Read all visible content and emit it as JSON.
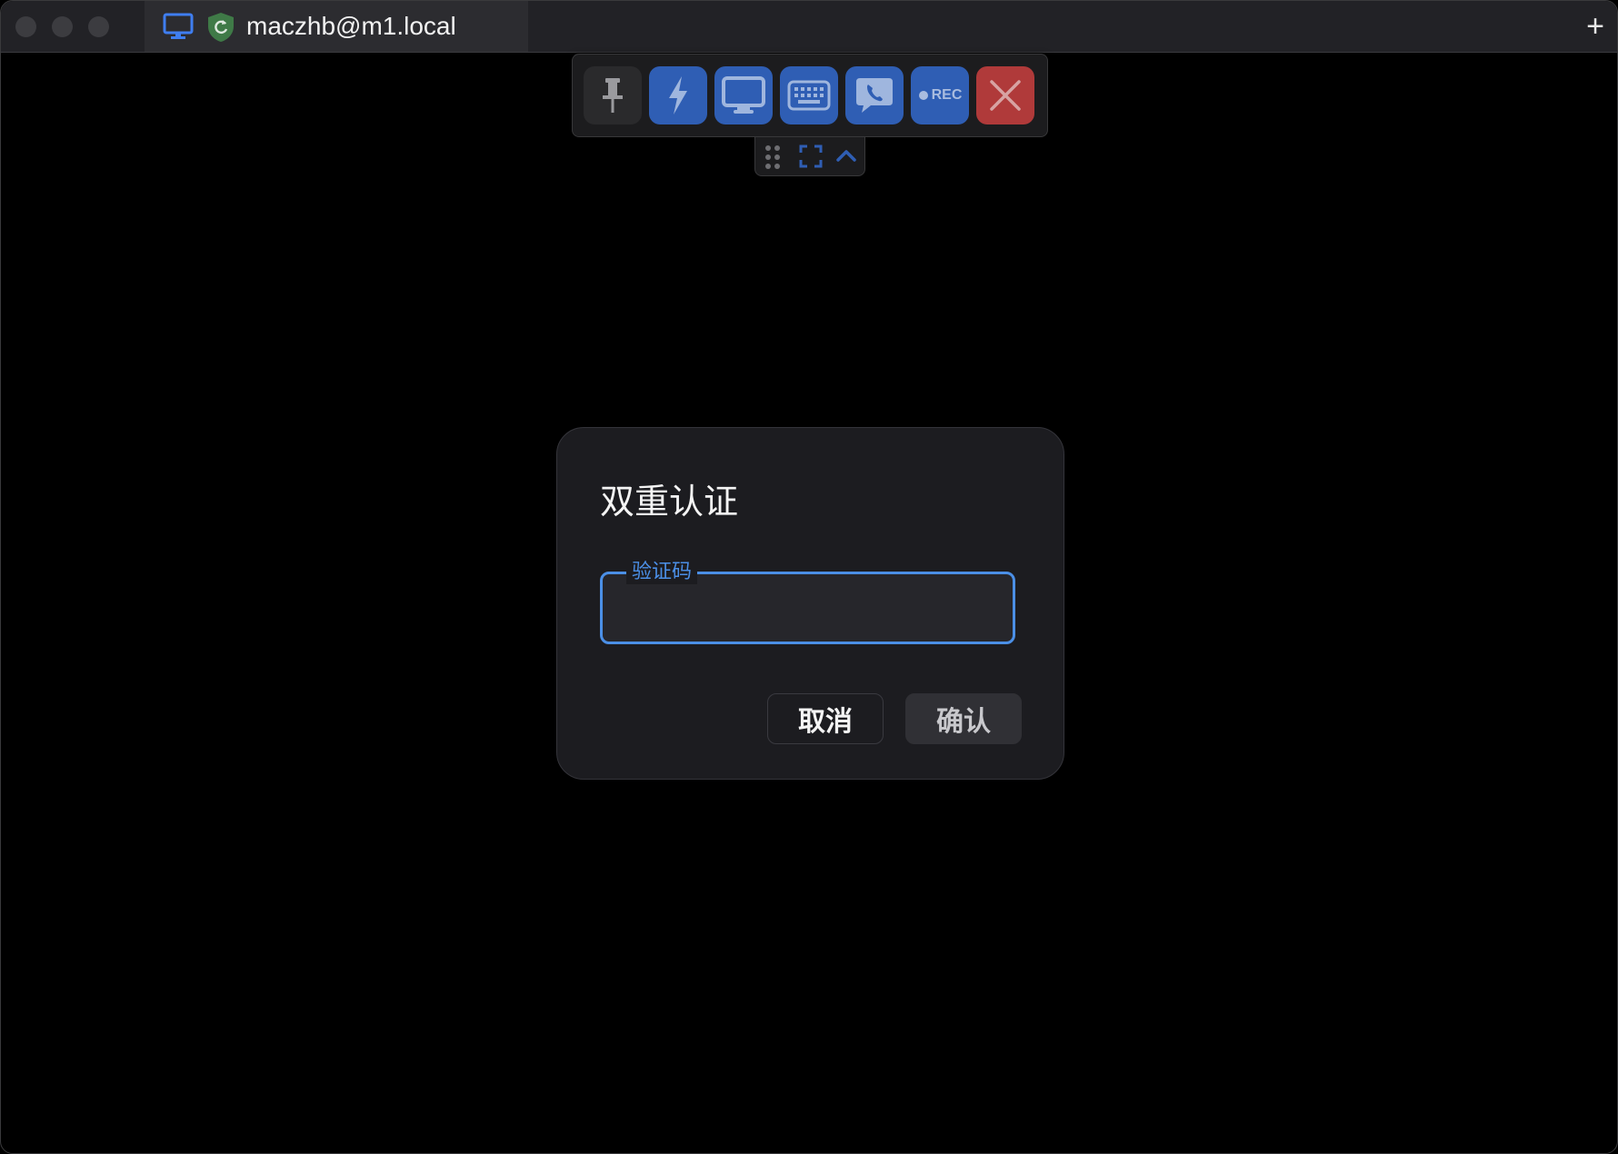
{
  "window": {
    "tab_title": "maczhb@m1.local",
    "add_tab_label": "+"
  },
  "toolbar": {
    "buttons": [
      {
        "name": "pin",
        "icon": "pin-icon"
      },
      {
        "name": "action",
        "icon": "lightning-icon"
      },
      {
        "name": "display",
        "icon": "monitor-icon"
      },
      {
        "name": "keyboard",
        "icon": "keyboard-icon"
      },
      {
        "name": "chat",
        "icon": "chat-phone-icon"
      },
      {
        "name": "record",
        "icon": "record-icon",
        "label": "REC"
      },
      {
        "name": "close",
        "icon": "close-icon"
      }
    ]
  },
  "subbar": {
    "icons": [
      "drag-handle-icon",
      "fullscreen-icon",
      "chevron-up-icon"
    ]
  },
  "dialog": {
    "title": "双重认证",
    "field_label": "验证码",
    "field_value": "",
    "cancel_label": "取消",
    "confirm_label": "确认"
  },
  "colors": {
    "accent": "#4b8fe6",
    "toolbar_blue": "#2f5eb4",
    "close_red": "#b03a3a",
    "shield_green": "#3f7a47"
  }
}
